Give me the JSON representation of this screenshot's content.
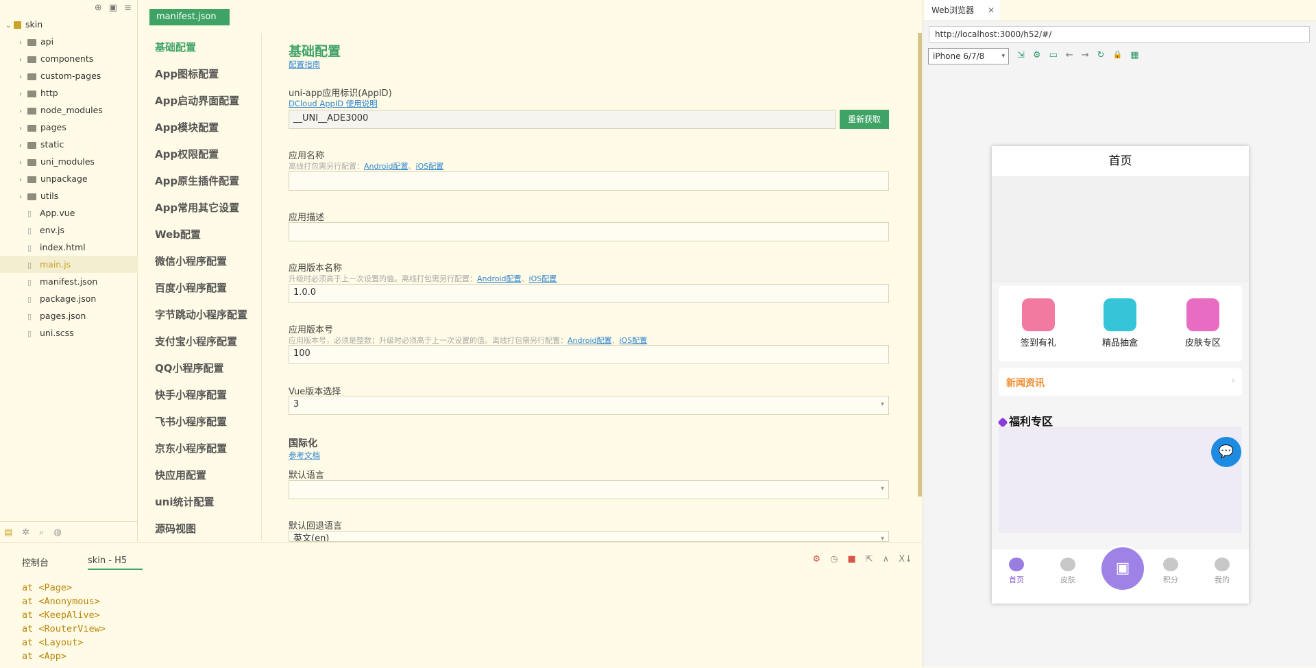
{
  "filetree": {
    "toolbar": [
      "⊕",
      "▣",
      "≡"
    ],
    "root": "skin",
    "items": [
      {
        "label": "api",
        "type": "folder"
      },
      {
        "label": "components",
        "type": "folder"
      },
      {
        "label": "custom-pages",
        "type": "folder"
      },
      {
        "label": "http",
        "type": "folder"
      },
      {
        "label": "node_modules",
        "type": "folder"
      },
      {
        "label": "pages",
        "type": "folder"
      },
      {
        "label": "static",
        "type": "folder"
      },
      {
        "label": "uni_modules",
        "type": "folder"
      },
      {
        "label": "unpackage",
        "type": "folder"
      },
      {
        "label": "utils",
        "type": "folder"
      },
      {
        "label": "App.vue",
        "type": "file"
      },
      {
        "label": "env.js",
        "type": "file"
      },
      {
        "label": "index.html",
        "type": "file"
      },
      {
        "label": "main.js",
        "type": "file",
        "active": true
      },
      {
        "label": "manifest.json",
        "type": "file"
      },
      {
        "label": "package.json",
        "type": "file"
      },
      {
        "label": "pages.json",
        "type": "file"
      },
      {
        "label": "uni.scss",
        "type": "file"
      }
    ]
  },
  "editor": {
    "tab": "manifest.json",
    "nav": [
      "基础配置",
      "App图标配置",
      "App启动界面配置",
      "App模块配置",
      "App权限配置",
      "App原生插件配置",
      "App常用其它设置",
      "Web配置",
      "微信小程序配置",
      "百度小程序配置",
      "字节跳动小程序配置",
      "支付宝小程序配置",
      "QQ小程序配置",
      "快手小程序配置",
      "飞书小程序配置",
      "京东小程序配置",
      "快应用配置",
      "uni统计配置",
      "源码视图"
    ],
    "form": {
      "title": "基础配置",
      "guide_link": "配置指南",
      "appid_label": "uni-app应用标识(AppID)",
      "appid_link": "DCloud AppID 使用说明",
      "appid_value": "__UNI__ADE3000",
      "refresh_btn": "重新获取",
      "name_label": "应用名称",
      "name_hint": "离线打包需另行配置：",
      "android_link": "Android配置",
      "sep": "、",
      "ios_link": "iOS配置",
      "desc_label": "应用描述",
      "vname_label": "应用版本名称",
      "vname_hint": "升级时必须高于上一次设置的值。离线打包需另行配置：",
      "vname_value": "1.0.0",
      "vcode_label": "应用版本号",
      "vcode_hint": "应用版本号，必须是整数；升级时必须高于上一次设置的值。离线打包需另行配置：",
      "vcode_value": "100",
      "vue_label": "Vue版本选择",
      "vue_value": "3",
      "i18n_title": "国际化",
      "i18n_link": "参考文档",
      "lang_label": "默认语言",
      "fallback_label": "默认回退语言",
      "fallback_value": "英文(en)"
    }
  },
  "console": {
    "tab1": "控制台",
    "tab2": "skin - H5",
    "tools": [
      "⚙",
      "◷",
      "■",
      "⇱",
      "∧",
      "X↓"
    ],
    "lines": [
      "at <Page>",
      "at <Anonymous>",
      "at <KeepAlive>",
      "at <RouterView>",
      "at <Layout>",
      "at <App>"
    ]
  },
  "browser": {
    "tab": "Web浏览器",
    "close": "✕",
    "url": "http://localhost:3000/h52/#/",
    "device": "iPhone 6/7/8",
    "tools": [
      "⇲",
      "⚙",
      "▭",
      "←",
      "→",
      "↻",
      "🔒",
      "▦"
    ],
    "phone": {
      "title": "首页",
      "grid": [
        {
          "label": "签到有礼",
          "color": "#f27aa0"
        },
        {
          "label": "精品抽盒",
          "color": "#36c5d8"
        },
        {
          "label": "皮肤专区",
          "color": "#e86cc2"
        }
      ],
      "news": "新闻资讯",
      "news_arrow": "›",
      "welfare": "福利专区",
      "chat_icon": "💬",
      "tabs": [
        "首页",
        "皮肤",
        "积分",
        "我的"
      ],
      "center_icon": "▣"
    }
  }
}
